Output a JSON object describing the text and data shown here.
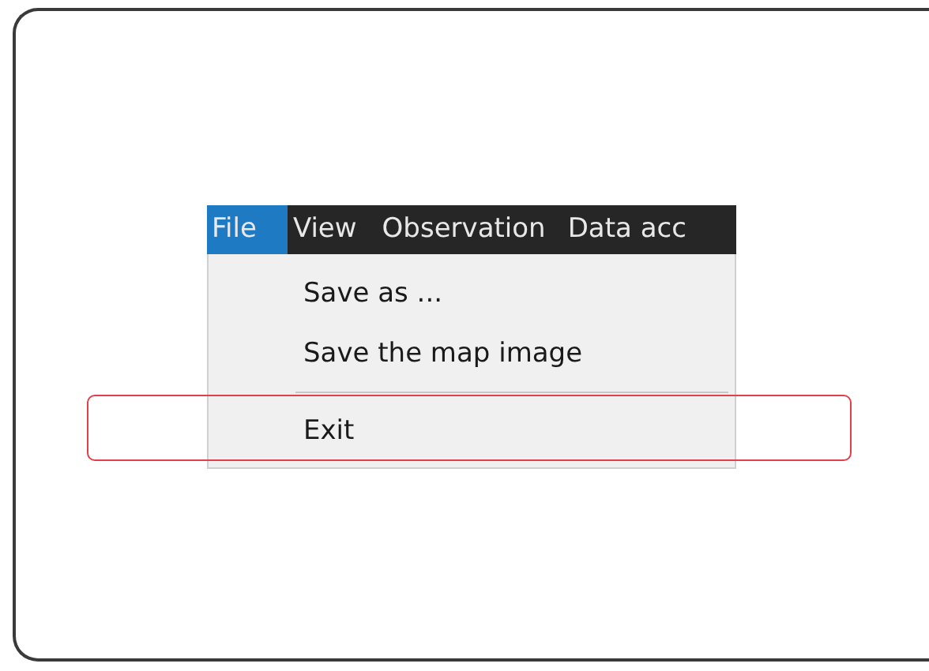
{
  "menubar": [
    {
      "label": "File",
      "selected": true
    },
    {
      "label": "View",
      "selected": false
    },
    {
      "label": "Observation",
      "selected": false
    },
    {
      "label": "Data acc",
      "selected": false
    }
  ],
  "menu": {
    "items": [
      {
        "kind": "item",
        "label": "Save as ...",
        "highlighted": false
      },
      {
        "kind": "item",
        "label": "Save the map image",
        "highlighted": false
      },
      {
        "kind": "separator"
      },
      {
        "kind": "item",
        "label": "Exit",
        "highlighted": true
      }
    ]
  }
}
